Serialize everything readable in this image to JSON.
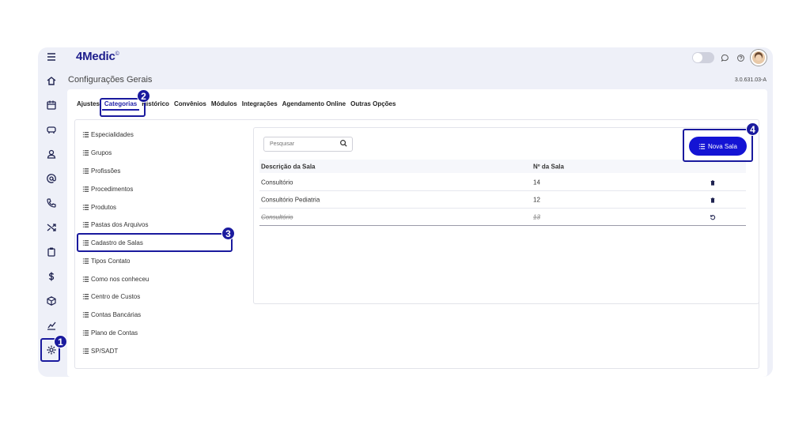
{
  "app": {
    "logo": "4Medic",
    "logo_mark": "©",
    "page_title": "Configurações Gerais",
    "version": "3.0.631.03-A"
  },
  "colors": {
    "accent": "#1414d4",
    "navy": "#1a1a9e",
    "background": "#eef0f8"
  },
  "sidebar": {
    "items": [
      {
        "icon": "menu-icon"
      },
      {
        "icon": "home-icon"
      },
      {
        "icon": "calendar-icon"
      },
      {
        "icon": "sofa-icon"
      },
      {
        "icon": "user-icon"
      },
      {
        "icon": "at-icon"
      },
      {
        "icon": "phone-icon"
      },
      {
        "icon": "shuffle-icon"
      },
      {
        "icon": "clipboard-icon"
      },
      {
        "icon": "dollar-icon"
      },
      {
        "icon": "box-icon"
      },
      {
        "icon": "chart-icon"
      },
      {
        "icon": "settings-gear-icon"
      }
    ]
  },
  "tabs": [
    "Ajustes",
    "Categorias",
    "Histórico",
    "Convênios",
    "Módulos",
    "Integrações",
    "Agendamento Online",
    "Outras Opções"
  ],
  "categories": [
    "Especialidades",
    "Grupos",
    "Profissões",
    "Procedimentos",
    "Produtos",
    "Pastas dos Arquivos",
    "Cadastro de Salas",
    "Tipos Contato",
    "Como nos conheceu",
    "Centro de Custos",
    "Contas Bancárias",
    "Plano de Contas",
    "SP/SADT"
  ],
  "search": {
    "placeholder": "Pesquisar"
  },
  "new_button": {
    "label": "Nova Sala"
  },
  "table": {
    "headers": [
      "Descrição da Sala",
      "Nº da Sala"
    ],
    "rows": [
      {
        "description": "Consultório",
        "number": "14",
        "action": "trash-icon",
        "disabled": false
      },
      {
        "description": "Consultório Pediatria",
        "number": "12",
        "action": "trash-icon",
        "disabled": false
      },
      {
        "description": "Consultório",
        "number": "13",
        "action": "restore-icon",
        "disabled": true
      }
    ]
  },
  "badges": [
    "1",
    "2",
    "3",
    "4"
  ]
}
